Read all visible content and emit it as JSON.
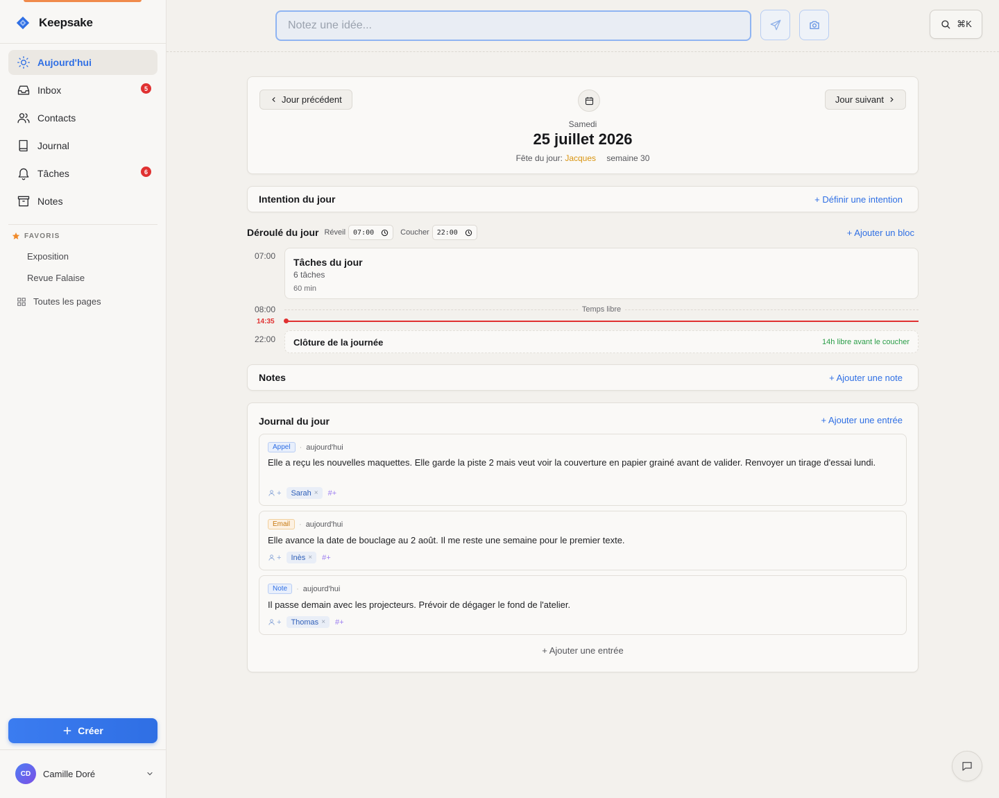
{
  "app": {
    "name": "Keepsake"
  },
  "sidebar": {
    "items": [
      {
        "label": "Aujourd'hui",
        "icon": "sun-icon",
        "active": true
      },
      {
        "label": "Inbox",
        "icon": "inbox-icon",
        "badge": "5"
      },
      {
        "label": "Contacts",
        "icon": "users-icon"
      },
      {
        "label": "Journal",
        "icon": "book-icon"
      },
      {
        "label": "Tâches",
        "icon": "bell-icon",
        "badge": "6"
      },
      {
        "label": "Notes",
        "icon": "archive-icon"
      }
    ],
    "favorites_title": "FAVORIS",
    "favorites": [
      "Exposition",
      "Revue Falaise"
    ],
    "all_pages": "Toutes les pages",
    "create_label": "Créer",
    "user": {
      "initials": "CD",
      "name": "Camille Doré"
    }
  },
  "topbar": {
    "placeholder": "Notez une idée...",
    "shortcut": "⌘K"
  },
  "date_card": {
    "prev": "Jour précédent",
    "next": "Jour suivant",
    "weekday": "Samedi",
    "date": "25 juillet 2026",
    "fete_prefix": "Fête du jour:",
    "saint": "Jacques",
    "week": "semaine 30"
  },
  "intention": {
    "title": "Intention du jour",
    "action": "+ Définir une intention"
  },
  "schedule": {
    "title": "Déroulé du jour",
    "wake_label": "Réveil",
    "wake": "07:00",
    "sleep_label": "Coucher",
    "sleep": "22:00",
    "add_block": "+ Ajouter un bloc",
    "block_time": "07:00",
    "block_title": "Tâches du jour",
    "block_sub": "6 tâches",
    "block_duration": "60 min",
    "free_time": "08:00",
    "free_label": "Temps libre",
    "now": "14:35",
    "close_time": "22:00",
    "close_title": "Clôture de la journée",
    "close_free": "14h libre avant le coucher"
  },
  "notes": {
    "title": "Notes",
    "action": "+ Ajouter une note"
  },
  "journal": {
    "title": "Journal du jour",
    "action": "+ Ajouter une entrée",
    "bottom_action": "+ Ajouter une entrée",
    "entries": [
      {
        "type": "Appel",
        "when": "aujourd'hui",
        "text": "Elle a reçu les nouvelles maquettes. Elle garde la piste 2 mais veut voir la couverture en papier grainé avant de valider. Renvoyer un tirage d'essai lundi.",
        "person": "Sarah"
      },
      {
        "type": "Email",
        "when": "aujourd'hui",
        "text": "Elle avance la date de bouclage au 2 août. Il me reste une semaine pour le premier texte.",
        "person": "Inès"
      },
      {
        "type": "Note",
        "when": "aujourd'hui",
        "text": "Il passe demain avec les projecteurs. Prévoir de dégager le fond de l'atelier.",
        "person": "Thomas"
      }
    ]
  },
  "colors": {
    "accent": "#2f6fe4",
    "badge": "#e03131",
    "saint": "#d9940f",
    "free": "#2a9d48"
  }
}
